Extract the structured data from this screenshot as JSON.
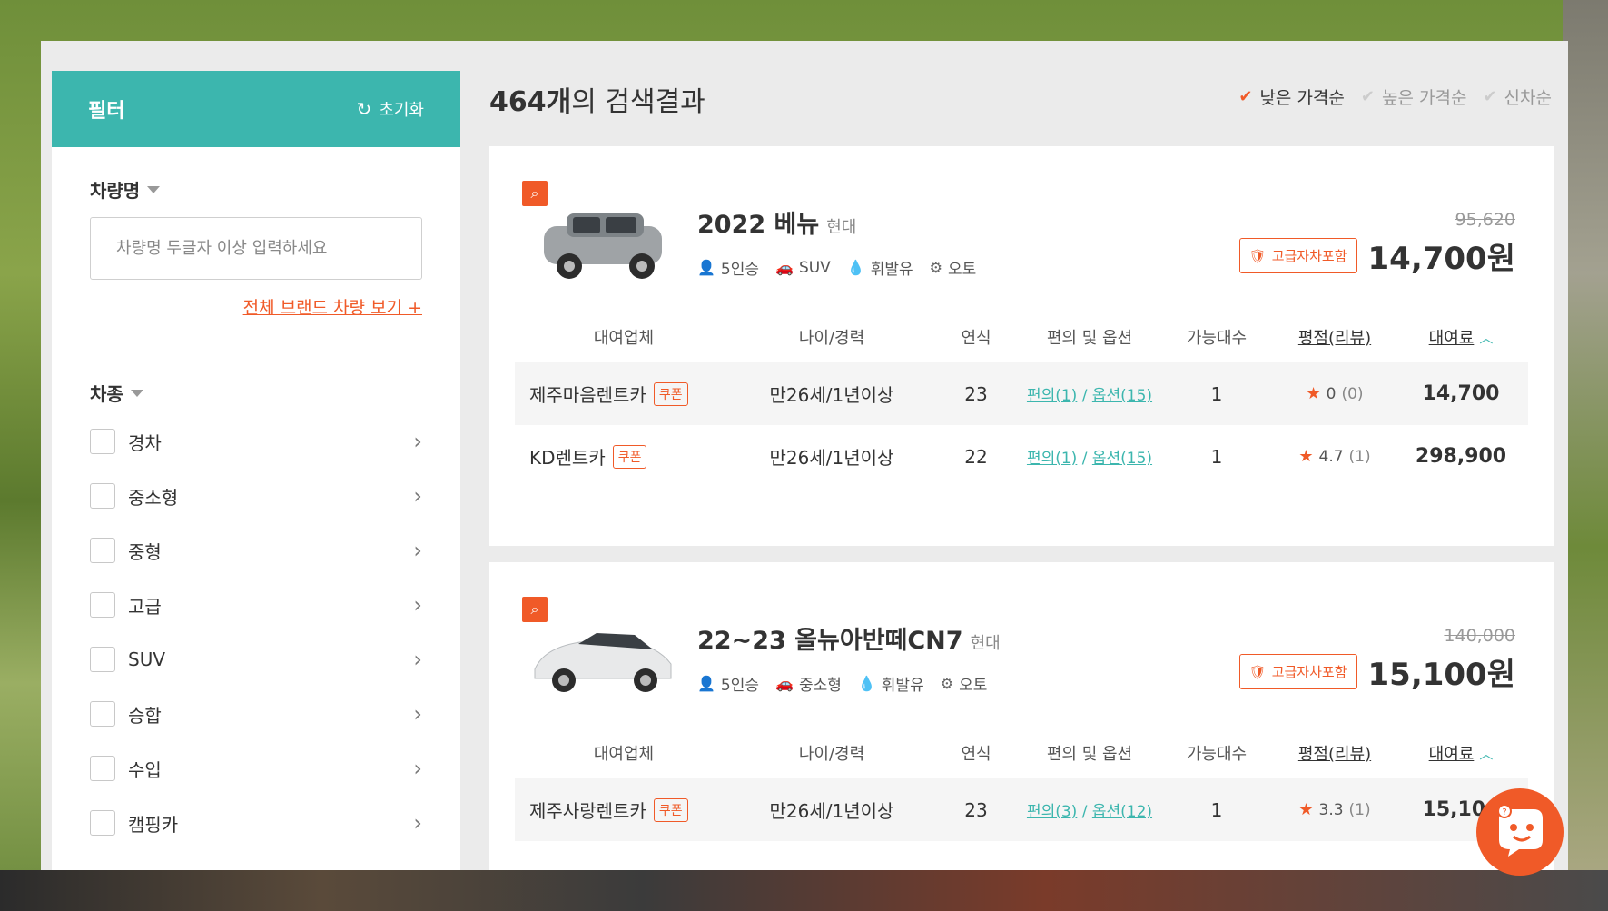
{
  "filter": {
    "title": "필터",
    "reset_label": "초기화",
    "name_label": "차량명",
    "name_placeholder": "차량명 두글자 이상 입력하세요",
    "brand_link": "전체 브랜드 차량 보기 +",
    "type_label": "차종",
    "types": [
      "경차",
      "중소형",
      "중형",
      "고급",
      "SUV",
      "승합",
      "수입",
      "캠핑카"
    ]
  },
  "results": {
    "count_bold": "464개",
    "count_suffix": "의 검색결과"
  },
  "sort": [
    "낮은 가격순",
    "높은 가격순",
    "신차순"
  ],
  "table_headers": [
    "대여업체",
    "나이/경력",
    "연식",
    "편의 및 옵션",
    "가능대수",
    "평점(리뷰)",
    "대여료"
  ],
  "cars": [
    {
      "name": "2022 베뉴",
      "brand": "현대",
      "specs": [
        "5인승",
        "SUV",
        "휘발유",
        "오토"
      ],
      "original_price": "95,620",
      "premium_badge": "고급자차포함",
      "price": "14,700원",
      "rows": [
        {
          "company": "제주마음렌트카",
          "coupon": "쿠폰",
          "age": "만26세/1년이상",
          "year": "23",
          "conv": "편의(1)",
          "opt": "옵션(15)",
          "avail": "1",
          "rating": "0",
          "reviews": "(0)",
          "fee": "14,700"
        },
        {
          "company": "KD렌트카",
          "coupon": "쿠폰",
          "age": "만26세/1년이상",
          "year": "22",
          "conv": "편의(1)",
          "opt": "옵션(15)",
          "avail": "1",
          "rating": "4.7",
          "reviews": "(1)",
          "fee": "298,900"
        }
      ]
    },
    {
      "name": "22~23 올뉴아반떼CN7",
      "brand": "현대",
      "specs": [
        "5인승",
        "중소형",
        "휘발유",
        "오토"
      ],
      "original_price": "140,000",
      "premium_badge": "고급자차포함",
      "price": "15,100원",
      "rows": [
        {
          "company": "제주사랑렌트카",
          "coupon": "쿠폰",
          "age": "만26세/1년이상",
          "year": "23",
          "conv": "편의(3)",
          "opt": "옵션(12)",
          "avail": "1",
          "rating": "3.3",
          "reviews": "(1)",
          "fee": "15,100"
        }
      ]
    }
  ],
  "icons": {
    "accent": "#3cb6ae",
    "orange": "#f05a28"
  }
}
